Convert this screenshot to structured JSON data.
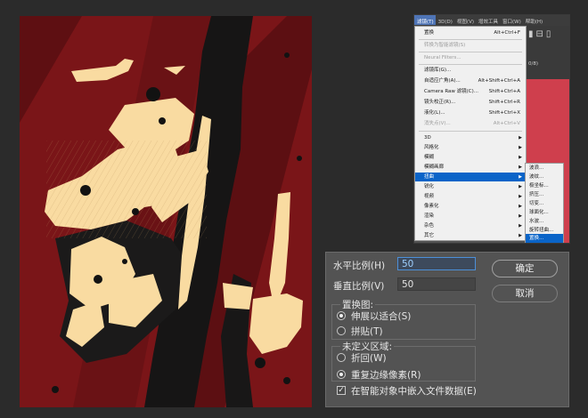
{
  "menubar": [
    "滤镜(T)",
    "3D(D)",
    "视图(V)",
    "增效工具",
    "窗口(W)",
    "帮助(H)"
  ],
  "menu": {
    "top": {
      "label": "置换",
      "shortcut": "Alt+Ctrl+F"
    },
    "convert_smart": "转换为智能滤镜(S)",
    "neural": "Neural Filters...",
    "gallery": "滤镜库(G)...",
    "adaptive_wide": {
      "label": "自适应广角(A)...",
      "shortcut": "Alt+Shift+Ctrl+A"
    },
    "camera_raw": {
      "label": "Camera Raw 滤镜(C)...",
      "shortcut": "Shift+Ctrl+A"
    },
    "lens_correction": {
      "label": "镜头校正(R)...",
      "shortcut": "Shift+Ctrl+R"
    },
    "liquify": {
      "label": "液化(L)...",
      "shortcut": "Shift+Ctrl+X"
    },
    "vanishing": {
      "label": "消失点(V)...",
      "shortcut": "Alt+Ctrl+V"
    },
    "categories": [
      "3D",
      "风格化",
      "模糊",
      "模糊画廊",
      "扭曲",
      "锐化",
      "视频",
      "像素化",
      "渲染",
      "杂色",
      "其它"
    ],
    "highlighted": "扭曲"
  },
  "submenu": [
    "波浪...",
    "波纹...",
    "极坐标...",
    "挤压...",
    "切变...",
    "球面化...",
    "水波...",
    "旋转扭曲...",
    "置换..."
  ],
  "panel": {
    "doc_tab": "0/8)",
    "icons": "▮⊟▯"
  },
  "dialog": {
    "horizontal_label": "水平比例(H)",
    "horizontal_value": "50",
    "vertical_label": "垂直比例(V)",
    "vertical_value": "50",
    "ok": "确定",
    "cancel": "取消",
    "map_group": "置换图:",
    "stretch": "伸展以适合(S)",
    "tile": "拼贴(T)",
    "undef_group": "未定义区域:",
    "wrap": "折回(W)",
    "repeat_edge": "重复边缘像素(R)",
    "embed": "在智能对象中嵌入文件数据(E)"
  },
  "colors": {
    "canvas_red": "#7a1518",
    "cream": "#f9dba1",
    "accent_blue": "#0a64c8"
  }
}
